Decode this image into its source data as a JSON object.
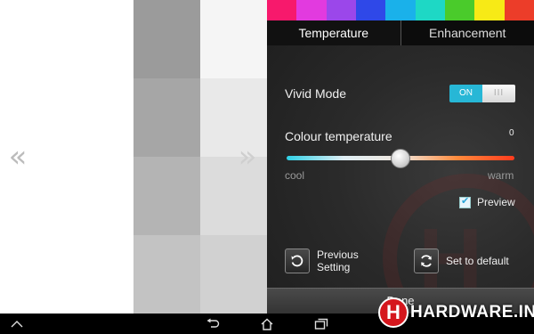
{
  "colors": {
    "swatches": [
      "#f7196c",
      "#e23adf",
      "#9b47ea",
      "#2f48e8",
      "#1ab1ea",
      "#1ed8c5",
      "#4acb2b",
      "#f7ea16",
      "#ec3d29"
    ],
    "gray_grid": [
      "#9b9b9b",
      "#f5f5f5",
      "#a6a6a6",
      "#e9e9e9",
      "#b4b4b4",
      "#dcdcdc",
      "#c3c3c3",
      "#d1d1d1"
    ],
    "slider_gradient": [
      "#2fd1e6",
      "#dfeef4",
      "#f0e7de",
      "#ff8a3c",
      "#ff3b1d"
    ],
    "toggle_on": "#27b7d6"
  },
  "tabs": [
    {
      "label": "Temperature",
      "active": true
    },
    {
      "label": "Enhancement",
      "active": false
    }
  ],
  "vivid_mode": {
    "label": "Vivid Mode",
    "on_label": "ON",
    "off_label": "III",
    "state": "on"
  },
  "colour_temperature": {
    "label": "Colour temperature",
    "value": "0",
    "min_label": "cool",
    "max_label": "warm",
    "position_fraction": 0.5
  },
  "preview": {
    "label": "Preview",
    "checked": true
  },
  "buttons": {
    "previous_setting": "Previous Setting",
    "set_to_default": "Set to default",
    "done": "Done"
  },
  "icons": {
    "left_nav": "double-chevron-left-icon",
    "right_nav": "double-chevron-right-icon",
    "previous": "undo-icon",
    "default": "refresh-icon"
  },
  "watermark": {
    "logo_letter": "H",
    "logo_text": "HARDWARE.INFO"
  }
}
